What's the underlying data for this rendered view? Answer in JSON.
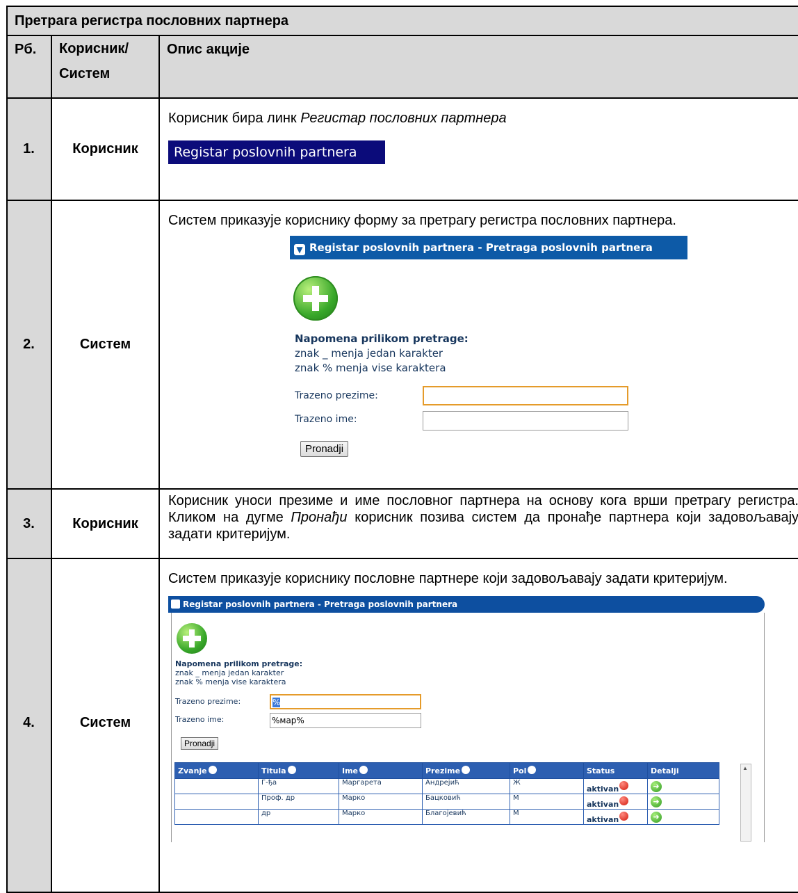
{
  "title": "Претрага регистра пословних партнера",
  "header": {
    "col1": "Рб.",
    "col2a": "Корисник/",
    "col2b": "Систем",
    "col3": "Опис акције"
  },
  "rows": [
    {
      "num": "1.",
      "actor": "Корисник",
      "text_pre": "Корисник бира линк ",
      "text_em": "Регистар пословних партнера",
      "link_label": "Registar poslovnih partnera"
    },
    {
      "num": "2.",
      "actor": "Систем",
      "text": "Систем приказује кориснику форму за претрагу регистра пословних партнера."
    },
    {
      "num": "3.",
      "actor": "Корисник",
      "text_pre": "Корисник уноси презиме и име пословног партнера на основу кога врши претрагу регистра. Кликом на дугме ",
      "text_em": "Пронађи",
      "text_post": " корисник позива систем да пронађе партнера који задовољавају задати критеријум."
    },
    {
      "num": "4.",
      "actor": "Систем",
      "text": "Систем приказује кориснику пословне партнере који задовољавају задати критеријум."
    }
  ],
  "form": {
    "panel_title": "Registar poslovnih partnera - Pretraga poslovnih partnera",
    "note_title": "Napomena prilikom pretrage:",
    "note_line1": "znak _ menja jedan karakter",
    "note_line2": "znak % menja vise karaktera",
    "label_prezime": "Trazeno prezime:",
    "label_ime": "Trazeno ime:",
    "button": "Pronadji"
  },
  "results": {
    "prezime_value": "%",
    "ime_value": "%мар%",
    "columns": [
      "Zvanje",
      "Titula",
      "Ime",
      "Prezime",
      "Pol",
      "Status",
      "Detalji"
    ],
    "rows": [
      {
        "zvanje": "",
        "titula": "Г-ђа",
        "ime": "Маргарета",
        "prezime": "Андрејић",
        "pol": "Ж",
        "status": "aktivan"
      },
      {
        "zvanje": "",
        "titula": "Проф. др",
        "ime": "Марко",
        "prezime": "Бацковић",
        "pol": "М",
        "status": "aktivan"
      },
      {
        "zvanje": "",
        "titula": "др",
        "ime": "Марко",
        "prezime": "Благојевић",
        "pol": "М",
        "status": "aktivan"
      }
    ]
  },
  "icons": {
    "expand": "chevron-down-icon",
    "add": "plus-circle-icon",
    "sort": "sort-arrow-icon",
    "status": "red-dot-icon",
    "details": "arrow-right-circle-icon"
  },
  "colors": {
    "header_bg": "#d9d9d9",
    "link_banner": "#0b0b7a",
    "panel_bar": "#0d5aa7",
    "table_header": "#2d5fb1",
    "focus_border": "#e59b2a"
  }
}
